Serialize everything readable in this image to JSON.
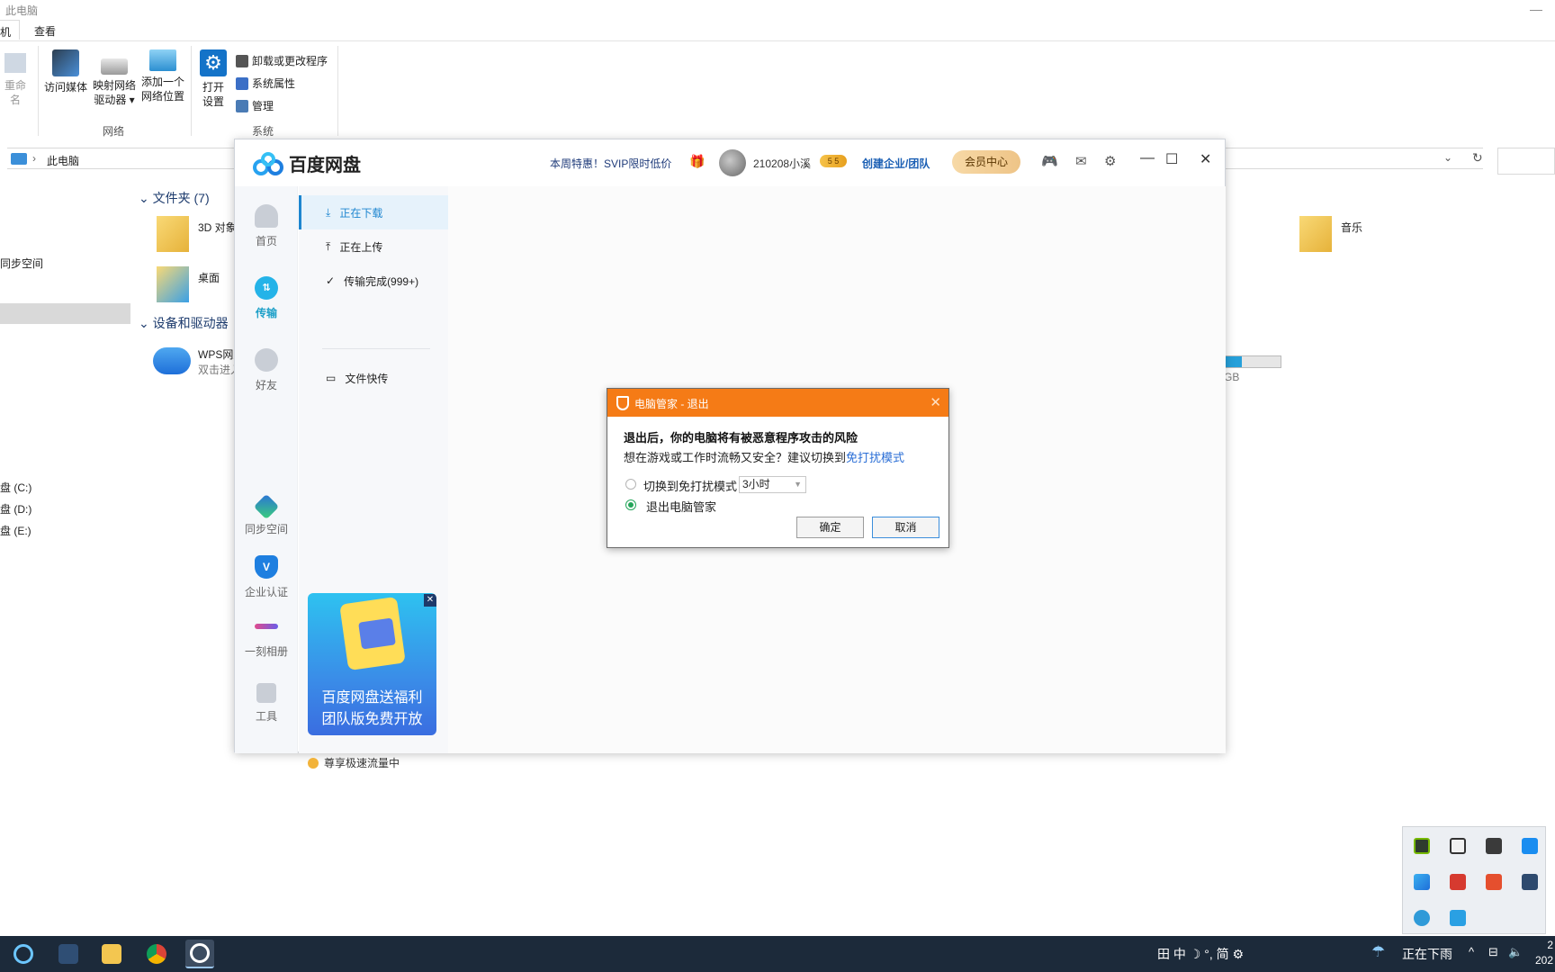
{
  "explorer": {
    "title": "此电脑",
    "tabs": [
      "机",
      "查看"
    ],
    "ribbon": {
      "rename_partial": "重命名",
      "access_media": "访问媒体",
      "map_drive_line1": "映射网络",
      "map_drive_line2": "驱动器 ▾",
      "add_location_line1": "添加一个",
      "add_location_line2": "网络位置",
      "open_settings_line1": "打开",
      "open_settings_line2": "设置",
      "uninstall": "卸载或更改程序",
      "system_properties": "系统属性",
      "manage": "管理",
      "group_network": "网络",
      "group_system": "系统"
    },
    "address": "此电脑",
    "nav": {
      "sync_space": "同步空间",
      "drive_c": "盘 (C:)",
      "drive_d": "盘 (D:)",
      "drive_e": "盘 (E:)"
    },
    "folders_heading": "文件夹 (7)",
    "folders": {
      "objects_3d": "3D 对象",
      "desktop": "桌面",
      "music": "音乐"
    },
    "devices_heading": "设备和驱动器",
    "wps": {
      "name": "WPS网盘",
      "desc": "双击进入"
    },
    "disk_gb": "GB",
    "disk_fill": 0.3
  },
  "baidu": {
    "app_title": "百度网盘",
    "promo": "本周特惠！SVIP限时低价",
    "username": "210208小溪",
    "vip_badge": "5 5",
    "enterprise": "创建企业/团队",
    "member_center": "会员中心",
    "rail": {
      "home": "首页",
      "transfer": "传输",
      "friends": "好友",
      "sync_space": "同步空间",
      "enterprise_cert": "企业认证",
      "album": "一刻相册",
      "tools": "工具"
    },
    "subnav": {
      "downloading": "正在下载",
      "uploading": "正在上传",
      "completed": "传输完成(999+)",
      "quick_transfer": "文件快传"
    },
    "ad": {
      "line1": "百度网盘送福利",
      "line2": "团队版免费开放",
      "close": "✕"
    },
    "speed_text": "尊享极速流量中"
  },
  "dialog": {
    "title": "电脑管家 - 退出",
    "heading": "退出后，你的电脑将有被恶意程序攻击的风险",
    "sub_prefix": "想在游戏或工作时流畅又安全？建议切换到",
    "sub_link": "免打扰模式",
    "option1": "切换到免打扰模式",
    "duration": "3小时",
    "option2": "退出电脑管家",
    "selected_option": 2,
    "confirm": "确定",
    "cancel": "取消"
  },
  "taskbar": {
    "ime": "田 中 ☽ °, 简 ⚙",
    "weather": "正在下雨",
    "clock_line1": "2",
    "clock_line2": "202"
  },
  "colors": {
    "dialog_title_bg": "#f57b16",
    "baidu_accent": "#1e86d0",
    "radio_on": "#25a55a",
    "taskbar_bg": "#1c2a3a"
  }
}
